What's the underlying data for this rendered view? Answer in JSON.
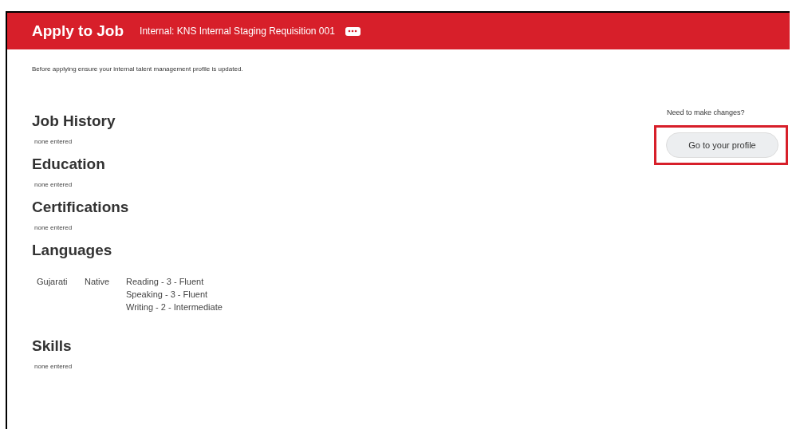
{
  "header": {
    "title": "Apply to Job",
    "subtitle": "Internal: KNS Internal Staging Requisition 001"
  },
  "intro": "Before applying ensure your internal talent management profile is updated.",
  "sections": [
    {
      "kind": "empty",
      "heading": "Job History",
      "note": "none entered"
    },
    {
      "kind": "empty",
      "heading": "Education",
      "note": "none entered"
    },
    {
      "kind": "empty",
      "heading": "Certifications",
      "note": "none entered"
    },
    {
      "kind": "languages",
      "heading": "Languages",
      "languages": [
        {
          "name": "Gujarati",
          "level": "Native",
          "abilities": [
            "Reading - 3 - Fluent",
            "Speaking - 3 - Fluent",
            "Writing - 2 - Intermediate"
          ]
        }
      ]
    },
    {
      "kind": "empty",
      "heading": "Skills",
      "note": "none entered"
    }
  ],
  "aside": {
    "prompt": "Need to make changes?",
    "button": {
      "label": "Go to your profile",
      "highlighted": true
    }
  }
}
